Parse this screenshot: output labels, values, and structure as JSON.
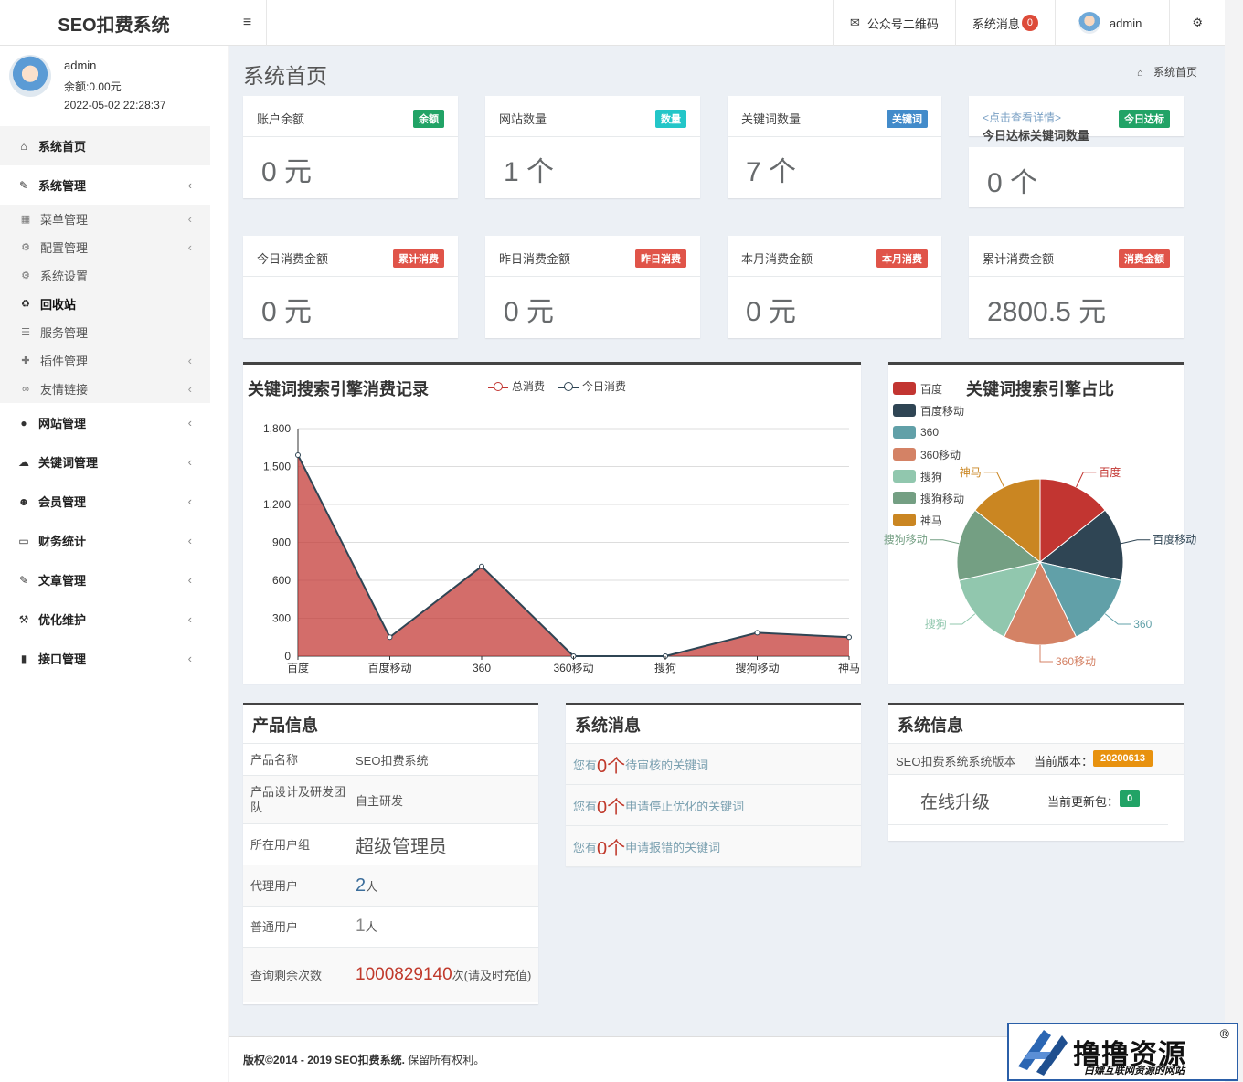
{
  "brand": "SEO扣费系统",
  "topbar": {
    "toggle": "≡",
    "wechat": "公众号二维码",
    "messages": "系统消息",
    "messages_count": "0",
    "user": "admin"
  },
  "sidebar": {
    "user": {
      "name": "admin",
      "balance": "余额:0.00元",
      "time": "2022-05-02 22:28:37"
    },
    "items": [
      {
        "label": "系统首页"
      },
      {
        "label": "系统管理"
      },
      {
        "label": "菜单管理"
      },
      {
        "label": "配置管理"
      },
      {
        "label": "系统设置"
      },
      {
        "label": "回收站"
      },
      {
        "label": "服务管理"
      },
      {
        "label": "插件管理"
      },
      {
        "label": "友情链接"
      },
      {
        "label": "网站管理"
      },
      {
        "label": "关键词管理"
      },
      {
        "label": "会员管理"
      },
      {
        "label": "财务统计"
      },
      {
        "label": "文章管理"
      },
      {
        "label": "优化维护"
      },
      {
        "label": "接口管理"
      }
    ]
  },
  "page": {
    "title": "系统首页",
    "breadcrumb": "系统首页"
  },
  "stats": [
    {
      "label": "账户余额",
      "tag": "余额",
      "value": "0 元",
      "tag_color": "#21a366"
    },
    {
      "label": "网站数量",
      "tag": "数量",
      "value": "1 个",
      "tag_color": "#23c6c8"
    },
    {
      "label": "关键词数量",
      "tag": "关键词",
      "value": "7 个",
      "tag_color": "#428bca"
    },
    {
      "label": "今日达标关键词数量",
      "link": "<点击查看详情>",
      "tag": "今日达标",
      "value": "0 个",
      "tag_color": "#21a366"
    },
    {
      "label": "今日消费金额",
      "tag": "累计消费",
      "value": "0 元",
      "tag_color": "#e05449"
    },
    {
      "label": "昨日消费金额",
      "tag": "昨日消费",
      "value": "0 元",
      "tag_color": "#e05449"
    },
    {
      "label": "本月消费金额",
      "tag": "本月消费",
      "value": "0 元",
      "tag_color": "#e05449"
    },
    {
      "label": "累计消费金额",
      "tag": "消费金额",
      "value": "2800.5 元",
      "tag_color": "#e05449"
    }
  ],
  "chart_data": [
    {
      "type": "area",
      "title": "关键词搜索引擎消费记录",
      "categories": [
        "百度",
        "百度移动",
        "360",
        "360移动",
        "搜狗",
        "搜狗移动",
        "神马"
      ],
      "series": [
        {
          "name": "总消费",
          "values": [
            1590,
            150,
            710,
            0,
            0,
            185,
            150
          ],
          "color": "#c23531"
        },
        {
          "name": "今日消费",
          "values": [
            1590,
            150,
            710,
            0,
            0,
            185,
            150
          ],
          "color": "#2f4554"
        }
      ],
      "yticks": [
        "0",
        "300",
        "600",
        "900",
        "1,200",
        "1,500",
        "1,800"
      ],
      "ylim": [
        0,
        1800
      ],
      "grid": true,
      "legend": "top"
    },
    {
      "type": "pie",
      "title": "关键词搜索引擎占比",
      "slices": [
        {
          "name": "百度",
          "value": 1,
          "color": "#c23531"
        },
        {
          "name": "百度移动",
          "value": 1,
          "color": "#2f4554"
        },
        {
          "name": "360",
          "value": 1,
          "color": "#61a0a8"
        },
        {
          "name": "360移动",
          "value": 1,
          "color": "#d48265"
        },
        {
          "name": "搜狗",
          "value": 1,
          "color": "#91c7ae"
        },
        {
          "name": "搜狗移动",
          "value": 1,
          "color": "#749f83"
        },
        {
          "name": "神马",
          "value": 1,
          "color": "#ca8622"
        }
      ],
      "legend": "left"
    }
  ],
  "product": {
    "title": "产品信息",
    "rows": [
      {
        "k": "产品名称",
        "v": "SEO扣费系统"
      },
      {
        "k": "产品设计及研发团队",
        "v": "自主研发"
      },
      {
        "k": "所在用户组",
        "v": "超级管理员"
      },
      {
        "k": "代理用户",
        "v_num": "2",
        "v_unit": "人"
      },
      {
        "k": "普通用户",
        "v_num": "1",
        "v_unit": "人"
      },
      {
        "k": "查询剩余次数",
        "v_num": "1000829140",
        "v_unit": "次(请及时充值)"
      }
    ]
  },
  "messages": {
    "title": "系统消息",
    "rows": [
      {
        "pre": "您有",
        "n": "0个",
        "text": "待审核的关键词"
      },
      {
        "pre": "您有",
        "n": "0个",
        "text": "申请停止优化的关键词"
      },
      {
        "pre": "您有",
        "n": "0个",
        "text": "申请报错的关键词"
      }
    ]
  },
  "sysinfo": {
    "title": "系统信息",
    "name": "SEO扣费系统系统版本",
    "ver_label": "当前版本：",
    "version": "20200613",
    "upgrade": "在线升级",
    "pkg_label": "当前更新包：",
    "pkg": "0"
  },
  "footer": {
    "copyright": "版权©2014 - 2019",
    "company": "SEO扣费系统.",
    "rights": "保留所有权利。"
  },
  "watermark": {
    "title": "撸撸资源",
    "sub": "白嫖互联网资源的网站",
    "reg": "®"
  }
}
